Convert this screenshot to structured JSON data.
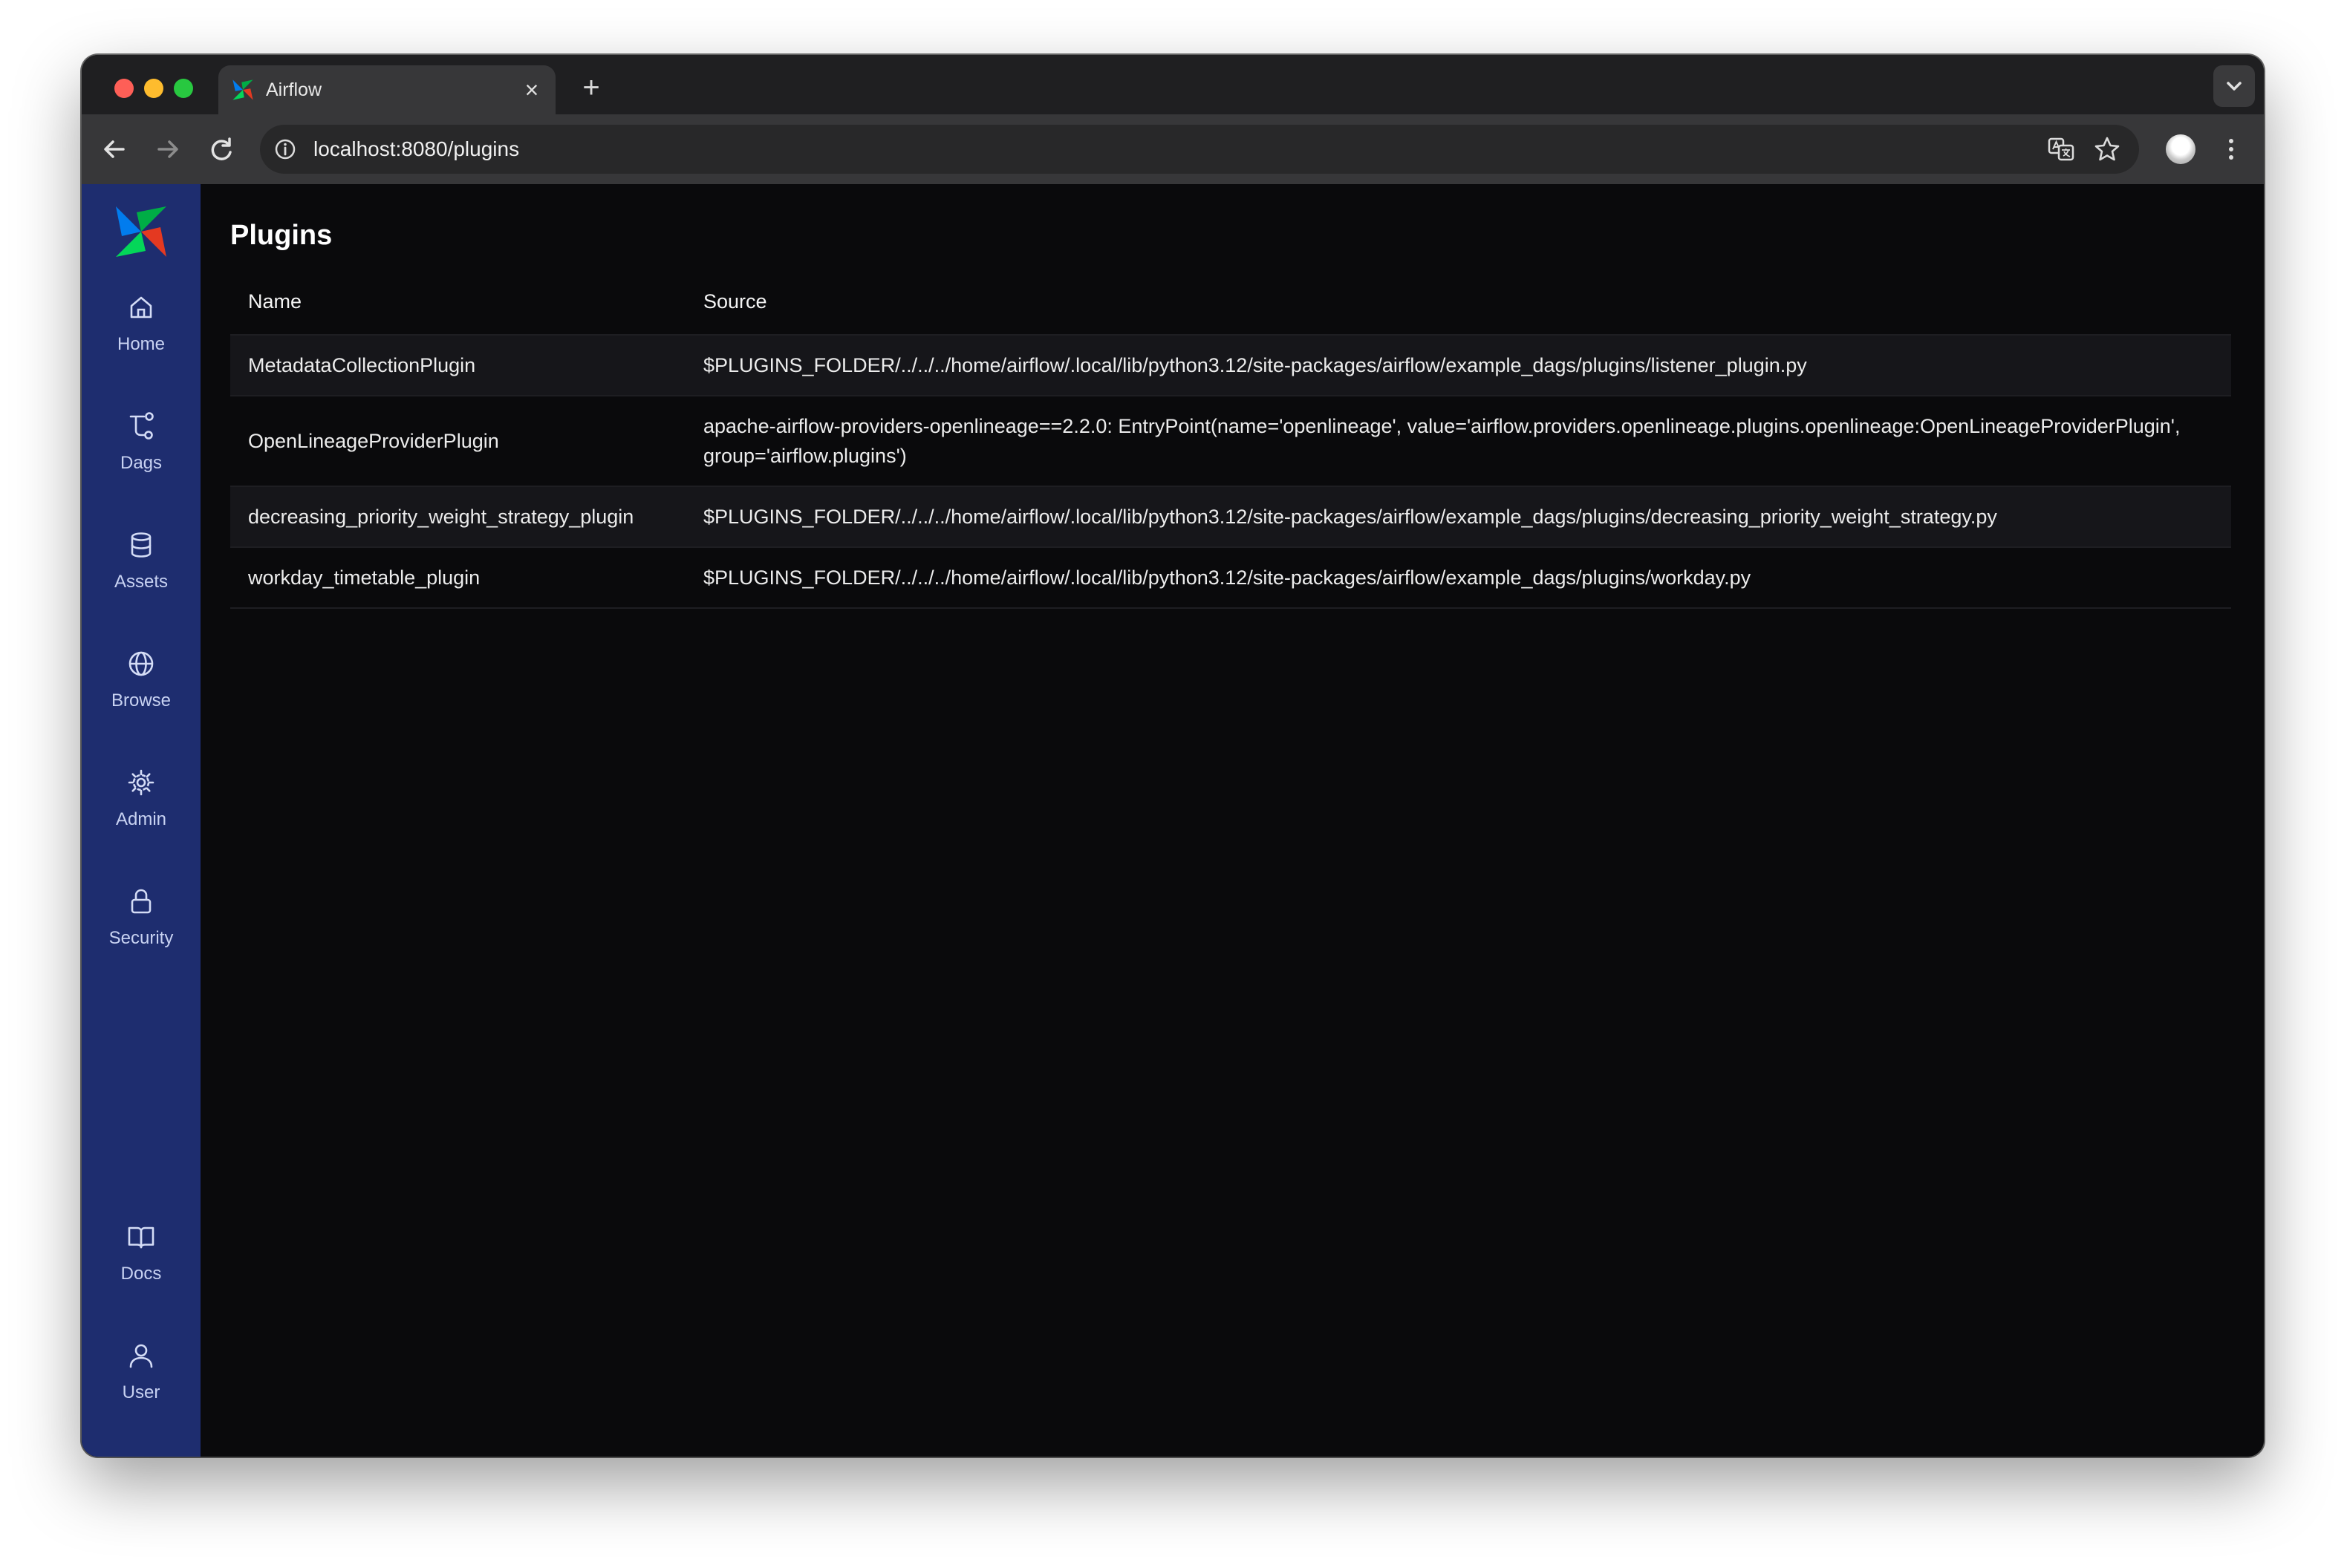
{
  "browser": {
    "tab_title": "Airflow",
    "tab_close_symbol": "×",
    "new_tab_symbol": "+",
    "url": "localhost:8080/plugins"
  },
  "sidebar": {
    "items": [
      {
        "label": "Home",
        "icon": "home-icon"
      },
      {
        "label": "Dags",
        "icon": "dags-icon"
      },
      {
        "label": "Assets",
        "icon": "database-icon"
      },
      {
        "label": "Browse",
        "icon": "globe-icon"
      },
      {
        "label": "Admin",
        "icon": "gear-icon"
      },
      {
        "label": "Security",
        "icon": "lock-icon"
      }
    ],
    "bottom_items": [
      {
        "label": "Docs",
        "icon": "book-icon"
      },
      {
        "label": "User",
        "icon": "user-icon"
      }
    ]
  },
  "page": {
    "title": "Plugins",
    "table": {
      "headers": [
        "Name",
        "Source"
      ],
      "rows": [
        {
          "name": "MetadataCollectionPlugin",
          "source": "$PLUGINS_FOLDER/../../../home/airflow/.local/lib/python3.12/site-packages/airflow/example_dags/plugins/listener_plugin.py"
        },
        {
          "name": "OpenLineageProviderPlugin",
          "source": "apache-airflow-providers-openlineage==2.2.0: EntryPoint(name='openlineage', value='airflow.providers.openlineage.plugins.openlineage:OpenLineageProviderPlugin', group='airflow.plugins')"
        },
        {
          "name": "decreasing_priority_weight_strategy_plugin",
          "source": "$PLUGINS_FOLDER/../../../home/airflow/.local/lib/python3.12/site-packages/airflow/example_dags/plugins/decreasing_priority_weight_strategy.py"
        },
        {
          "name": "workday_timetable_plugin",
          "source": "$PLUGINS_FOLDER/../../../home/airflow/.local/lib/python3.12/site-packages/airflow/example_dags/plugins/workday.py"
        }
      ]
    }
  },
  "colors": {
    "sidebar_bg": "#1e2d6f",
    "content_bg": "#0a0a0c",
    "row_alt_bg": "#16161a",
    "text": "#ececec"
  }
}
